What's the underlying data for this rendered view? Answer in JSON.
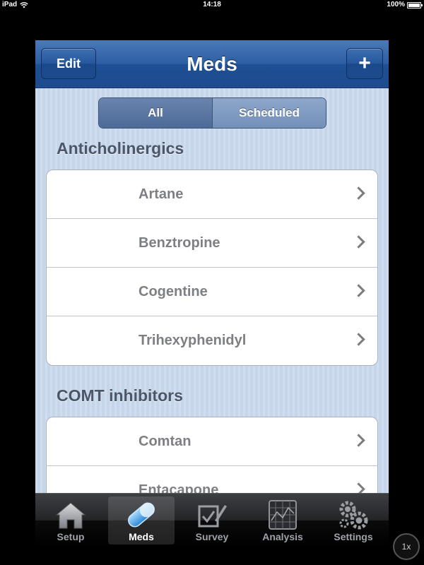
{
  "status_bar": {
    "device": "iPad",
    "time": "14:18",
    "battery": "100%",
    "battery_level": 1.0
  },
  "nav": {
    "title": "Meds",
    "edit_label": "Edit",
    "add_label": "+"
  },
  "segments": {
    "all": "All",
    "scheduled": "Scheduled",
    "selected": "All"
  },
  "sections": [
    {
      "header": "Anticholinergics",
      "items": [
        "Artane",
        "Benztropine",
        "Cogentine",
        "Trihexyphenidyl"
      ]
    },
    {
      "header": "COMT inhibitors",
      "items": [
        "Comtan",
        "Entacapone"
      ]
    }
  ],
  "tabs": [
    {
      "label": "Setup",
      "icon": "house-icon",
      "selected": false
    },
    {
      "label": "Meds",
      "icon": "pill-icon",
      "selected": true
    },
    {
      "label": "Survey",
      "icon": "checklist-icon",
      "selected": false
    },
    {
      "label": "Analysis",
      "icon": "chart-grid-icon",
      "selected": false
    },
    {
      "label": "Settings",
      "icon": "gears-icon",
      "selected": false
    }
  ],
  "zoom_button": "1x",
  "colors": {
    "nav_blue": "#2c5ea3",
    "background": "#c5d6ea",
    "pill_blue": "#4aa6e8"
  }
}
